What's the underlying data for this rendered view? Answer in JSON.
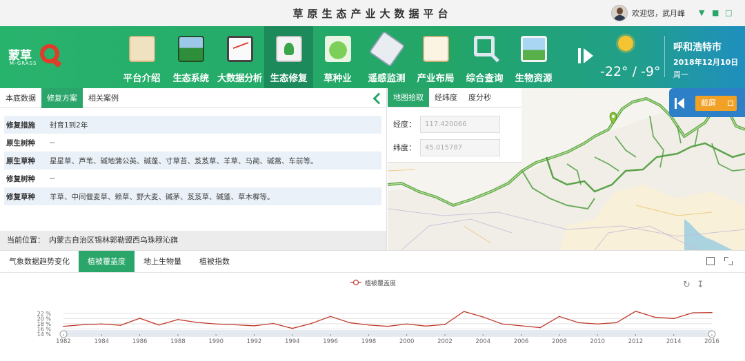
{
  "header": {
    "app_title": "草原生态产业大数据平台",
    "user_greeting": "欢迎您，武月峰",
    "icons": [
      "filter-icon",
      "shirt-icon",
      "window-icon"
    ]
  },
  "logo": {
    "name": "蒙草",
    "sub": "M-GRASS"
  },
  "nav": {
    "items": [
      {
        "label": "平台介绍",
        "icon": "document-icon"
      },
      {
        "label": "生态系统",
        "icon": "forest-icon"
      },
      {
        "label": "大数据分析",
        "icon": "chart-icon"
      },
      {
        "label": "生态修复",
        "icon": "repair-icon"
      },
      {
        "label": "草种业",
        "icon": "grass-dome-icon"
      },
      {
        "label": "遥感监测",
        "icon": "satellite-icon"
      },
      {
        "label": "产业布局",
        "icon": "certificate-icon"
      },
      {
        "label": "综合查询",
        "icon": "magnifier-icon"
      },
      {
        "label": "生物资源",
        "icon": "landscape-icon"
      }
    ],
    "active_index": 3
  },
  "weather": {
    "temperature": "-22° / -9°",
    "city": "呼和浩特市",
    "date": "2018年12月10日",
    "weekday": "周一"
  },
  "left_panel": {
    "tabs": [
      "本底数据",
      "修复方案",
      "相关案例"
    ],
    "active_tab": 1,
    "rows": [
      {
        "key": "修复措施",
        "value": "封育1到2年"
      },
      {
        "key": "原生树种",
        "value": "--"
      },
      {
        "key": "原生草种",
        "value": "星星草、芦苇、碱地蒲公英、碱蓬、寸草苔、芨芨草、羊草、马蔺、碱蒿、车前等。"
      },
      {
        "key": "修复树种",
        "value": "--"
      },
      {
        "key": "修复草种",
        "value": "羊草、中间偃麦草、赖草、野大麦、碱茅、芨芨草、碱蓬、草木樨等。"
      }
    ],
    "location_label": "当前位置：",
    "location_value": "内蒙古自治区锡林郭勒盟西乌珠穆沁旗"
  },
  "map_panel": {
    "tabs": [
      "地图拾取",
      "经纬度",
      "度分秒"
    ],
    "active_tab": 0,
    "longitude_label": "经度：",
    "longitude_value": "117.420066",
    "latitude_label": "纬度：",
    "latitude_value": "45.015787",
    "screenshot_label": "截屏"
  },
  "bottom_panel": {
    "tabs": [
      "气象数据趋势变化",
      "植被覆盖度",
      "地上生物量",
      "植被指数"
    ],
    "active_tab": 1
  },
  "chart_data": {
    "type": "line",
    "legend": "植被覆盖度",
    "x": [
      1982,
      1983,
      1984,
      1985,
      1986,
      1987,
      1988,
      1989,
      1990,
      1991,
      1992,
      1993,
      1994,
      1995,
      1996,
      1997,
      1998,
      1999,
      2000,
      2001,
      2002,
      2003,
      2004,
      2005,
      2006,
      2007,
      2008,
      2009,
      2010,
      2011,
      2012,
      2013,
      2014,
      2015,
      2016
    ],
    "x_ticks": [
      1982,
      1984,
      1986,
      1988,
      1990,
      1992,
      1994,
      1996,
      1998,
      2000,
      2002,
      2004,
      2006,
      2008,
      2010,
      2012,
      2014,
      2016
    ],
    "y_ticks": [
      "14 %",
      "16 %",
      "18 %",
      "20 %",
      "22 %"
    ],
    "ylim": [
      14,
      23
    ],
    "series": [
      {
        "name": "植被覆盖度",
        "color": "#c0392b",
        "values": [
          17.0,
          17.6,
          17.9,
          17.4,
          20.1,
          17.5,
          19.6,
          18.5,
          17.9,
          17.6,
          17.2,
          18.1,
          16.2,
          18.1,
          20.8,
          18.4,
          17.5,
          17.0,
          17.9,
          17.1,
          17.7,
          22.7,
          20.6,
          17.9,
          17.2,
          16.5,
          20.8,
          18.4,
          17.9,
          18.4,
          22.8,
          20.5,
          20.0,
          22.2,
          22.3
        ]
      }
    ],
    "series_color": "#c0392b"
  }
}
